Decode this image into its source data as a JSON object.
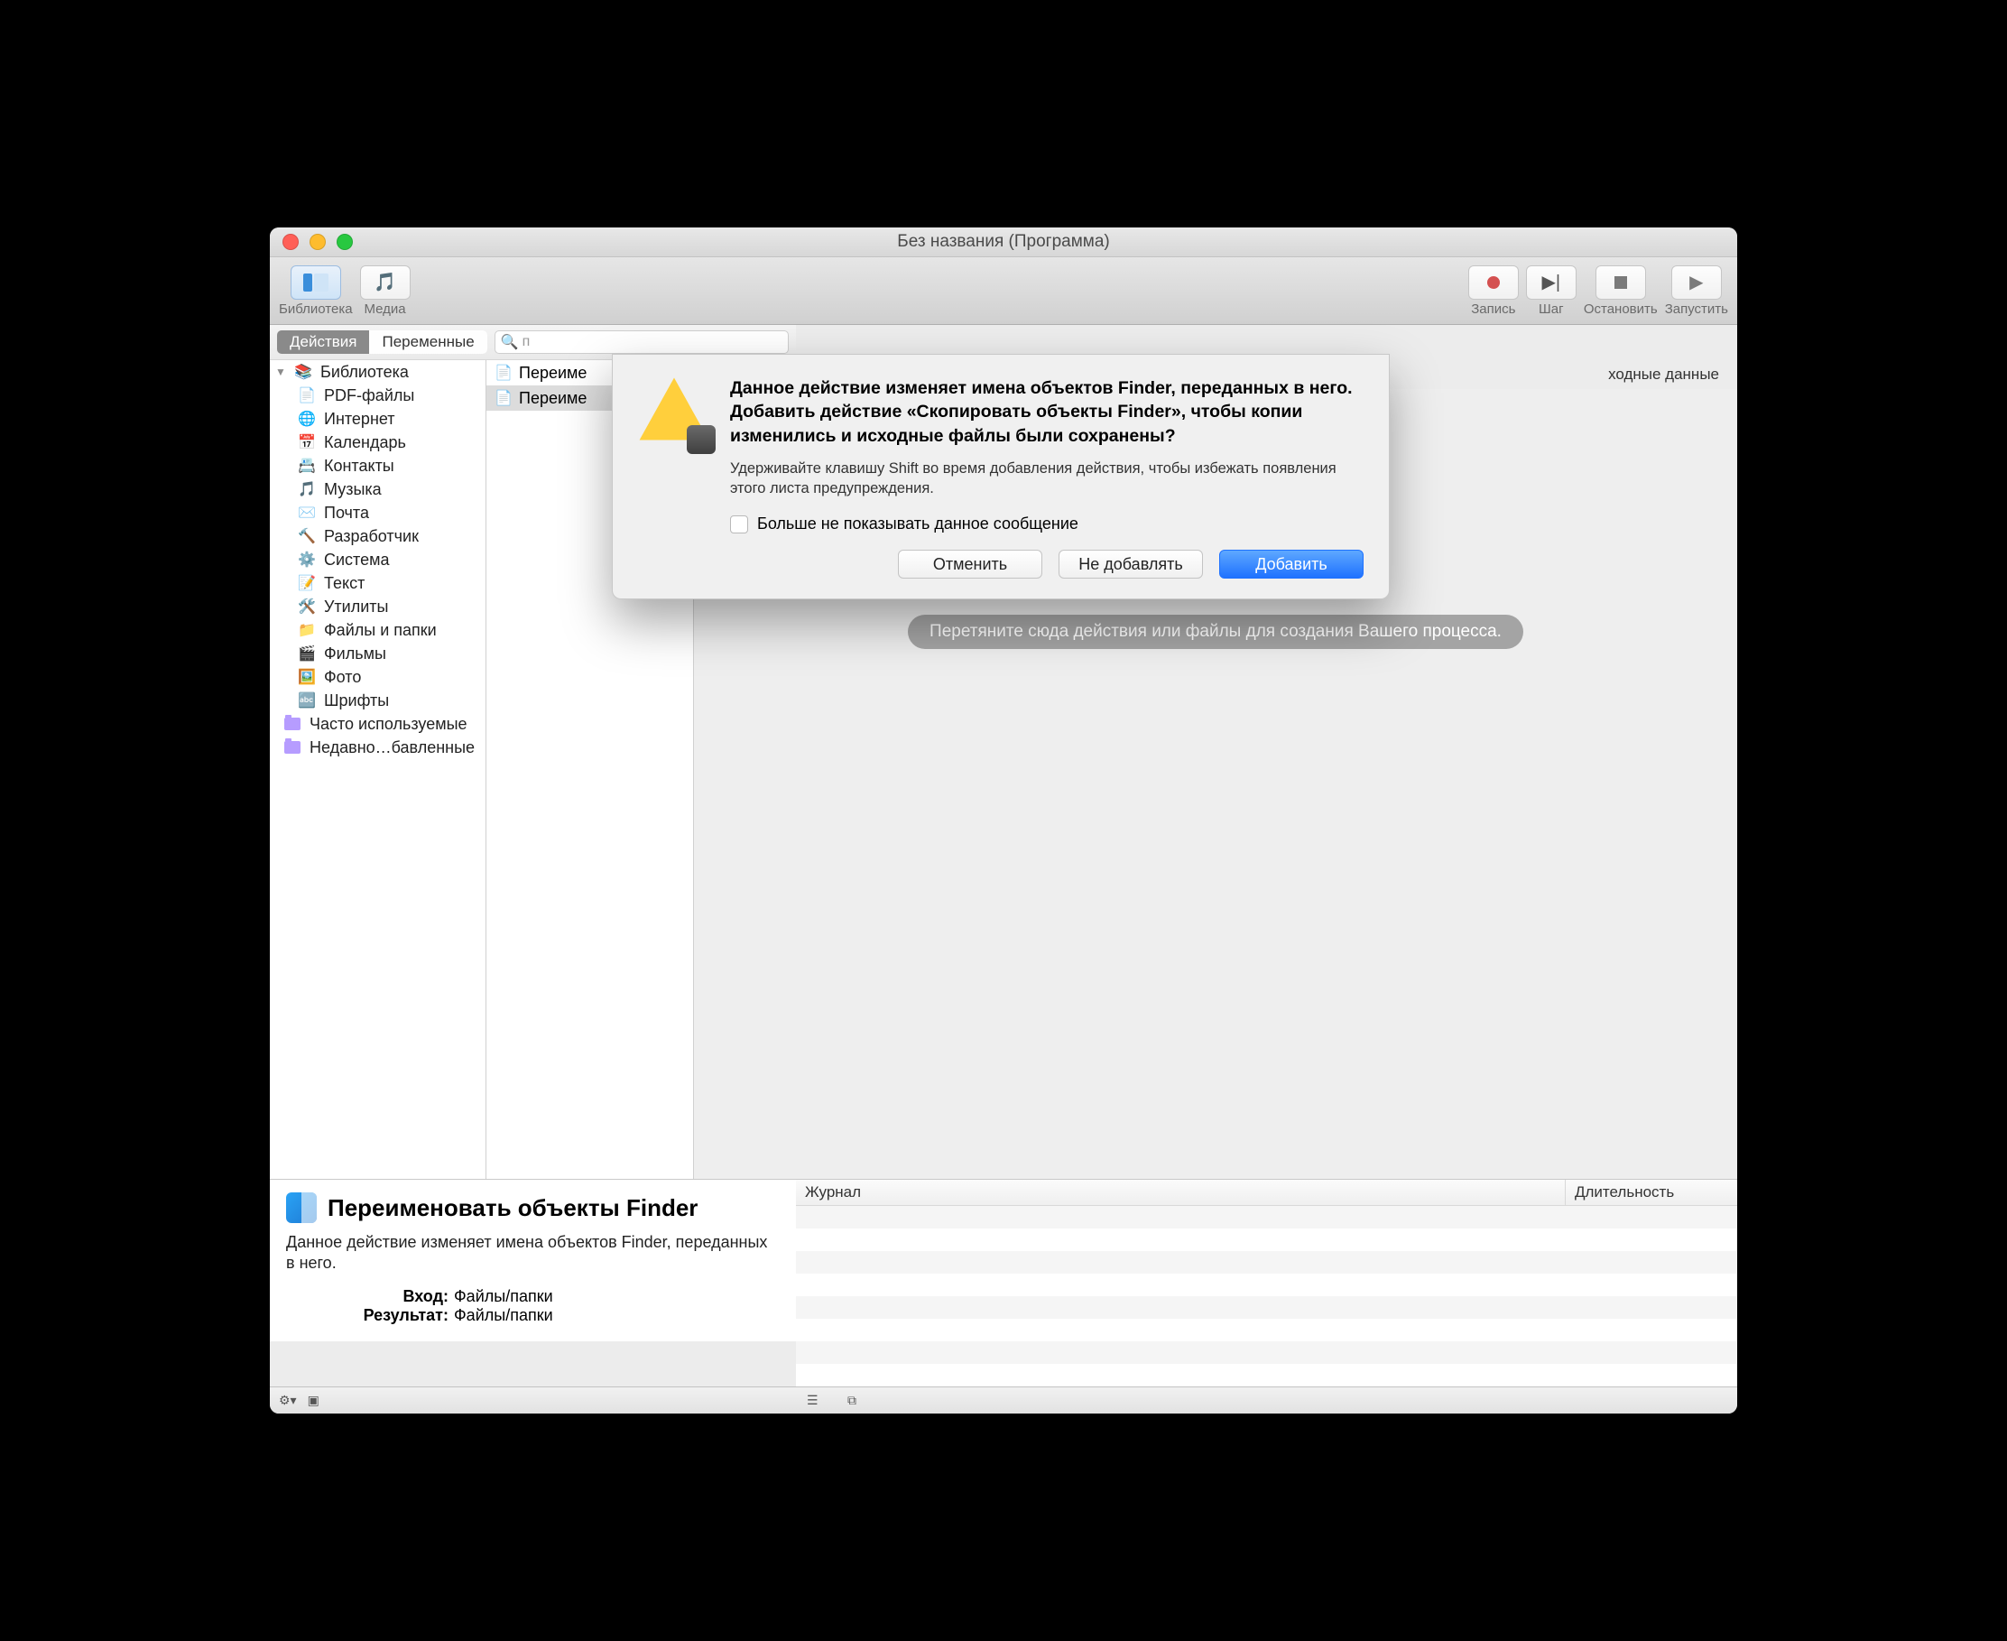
{
  "window": {
    "title": "Без названия (Программа)"
  },
  "toolbar": {
    "library": "Библиотека",
    "media": "Медиа",
    "record": "Запись",
    "step": "Шаг",
    "stop": "Остановить",
    "run": "Запустить"
  },
  "tabs": {
    "actions": "Действия",
    "variables": "Переменные"
  },
  "search": {
    "placeholder": "п"
  },
  "sidebar": {
    "library": "Библиотека",
    "items": [
      "PDF-файлы",
      "Интернет",
      "Календарь",
      "Контакты",
      "Музыка",
      "Почта",
      "Разработчик",
      "Система",
      "Текст",
      "Утилиты",
      "Файлы и папки",
      "Фильмы",
      "Фото",
      "Шрифты"
    ],
    "favorites": "Часто используемые",
    "recent": "Недавно…бавленные"
  },
  "actions_list": {
    "item1": "Переиме",
    "item2": "Переиме"
  },
  "canvas": {
    "input_hint_suffix": "ходные данные",
    "drop_hint": "Перетяните сюда действия или файлы для создания Вашего процесса."
  },
  "log": {
    "col1": "Журнал",
    "col2": "Длительность"
  },
  "detail": {
    "title": "Переименовать объекты Finder",
    "desc": "Данное действие изменяет имена объектов Finder, переданных в него.",
    "input_k": "Вход:",
    "input_v": "Файлы/папки",
    "result_k": "Результат:",
    "result_v": "Файлы/папки"
  },
  "dialog": {
    "heading": "Данное действие изменяет имена объектов Finder, переданных в него. Добавить действие «Скопировать объекты Finder», чтобы копии изменились и исходные файлы были сохранены?",
    "sub": "Удерживайте клавишу Shift во время добавления действия, чтобы избежать появления этого листа предупреждения.",
    "checkbox": "Больше не показывать данное сообщение",
    "cancel": "Отменить",
    "dont_add": "Не добавлять",
    "add": "Добавить"
  }
}
